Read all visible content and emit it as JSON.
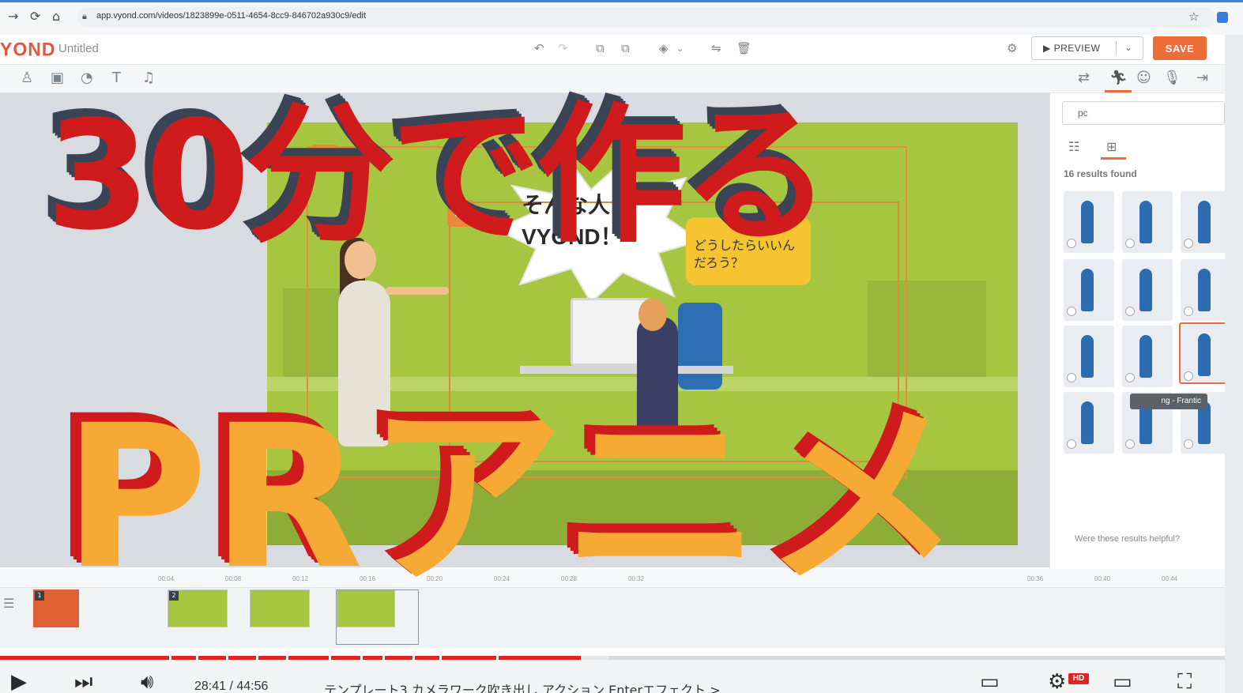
{
  "browser": {
    "url": "app.vyond.com/videos/1823899e-0511-4654-8cc9-846702a930c9/edit"
  },
  "app": {
    "logo": "YOND",
    "doc_title": "Untitled",
    "preview_label": "PREVIEW",
    "save_label": "SAVE"
  },
  "stage": {
    "burst_text": "そんな人に VYOND！",
    "bubble_text": "どうしたらいいんだろう？"
  },
  "panel": {
    "search_value": "pc",
    "results_label": "16 results found",
    "tooltip": "ng - Frantic",
    "helpful_label": "Were these results helpful?"
  },
  "timeline": {
    "ticks": [
      "00:04",
      "00:08",
      "00:12",
      "00:16",
      "00:20",
      "00:24",
      "00:28",
      "00:32",
      "00:36",
      "00:40",
      "00:44"
    ],
    "scenes": [
      "1",
      "2"
    ]
  },
  "player": {
    "time": "28:41 / 44:56",
    "chapter": "テンプレート3 カメラワーク吹き出し アクション Enterエフェクト >",
    "progress": 0.474,
    "hd_label": "HD"
  },
  "overlay": {
    "line1": "30分で作る",
    "line2": "PRアニメ"
  },
  "colors": {
    "accent": "#ec6c3a",
    "overlay_red": "#cf1b1b",
    "overlay_orange": "#f6a935",
    "stage_green": "#a6c642",
    "progress_red": "#e02424"
  }
}
